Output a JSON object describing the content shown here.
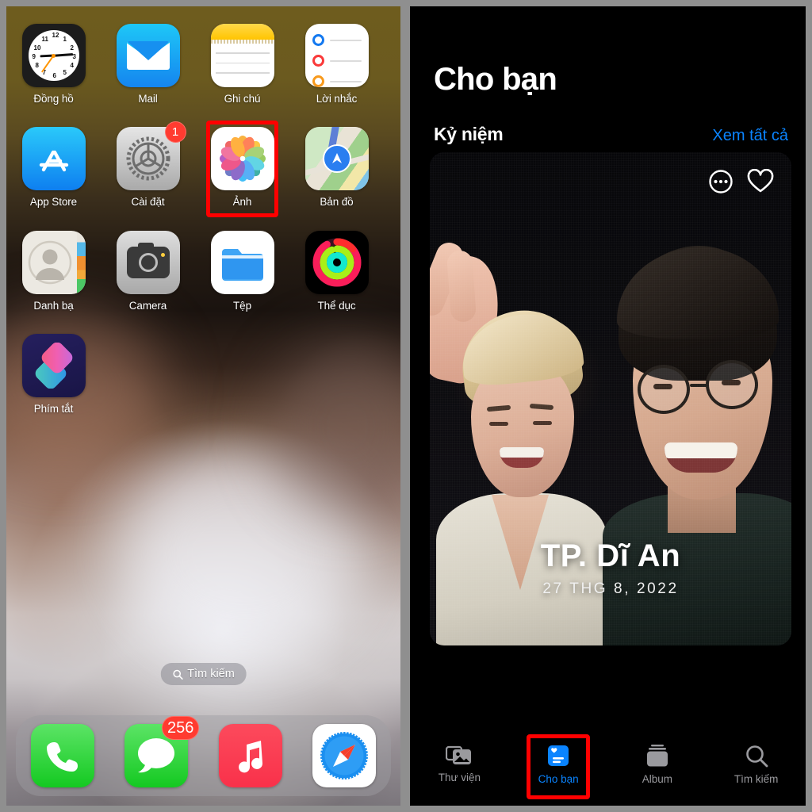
{
  "colors": {
    "highlight": "#ff0000",
    "accent_blue": "#0a84ff",
    "badge_red": "#ff3b30",
    "tab_inactive": "#9a9a9e",
    "panel_bg_dark": "#000000",
    "border_gray": "#8f8f8f"
  },
  "home_screen": {
    "rows": [
      [
        {
          "name": "Đồng hồ",
          "icon": "clock-icon"
        },
        {
          "name": "Mail",
          "icon": "mail-icon"
        },
        {
          "name": "Ghi chú",
          "icon": "notes-icon"
        },
        {
          "name": "Lời nhắc",
          "icon": "reminders-icon"
        }
      ],
      [
        {
          "name": "App Store",
          "icon": "app-store-icon"
        },
        {
          "name": "Cài đặt",
          "icon": "settings-icon",
          "badge": "1"
        },
        {
          "name": "Ảnh",
          "icon": "photos-icon",
          "highlighted": true
        },
        {
          "name": "Bản đồ",
          "icon": "maps-icon"
        }
      ],
      [
        {
          "name": "Danh bạ",
          "icon": "contacts-icon"
        },
        {
          "name": "Camera",
          "icon": "camera-icon"
        },
        {
          "name": "Tệp",
          "icon": "files-icon"
        },
        {
          "name": "Thể dục",
          "icon": "fitness-icon"
        }
      ],
      [
        {
          "name": "Phím tắt",
          "icon": "shortcuts-icon"
        }
      ]
    ],
    "search": {
      "label": "Tìm kiếm",
      "icon": "search-icon"
    },
    "dock": [
      {
        "name": "Phone",
        "icon": "phone-icon"
      },
      {
        "name": "Messages",
        "icon": "messages-icon",
        "badge": "256"
      },
      {
        "name": "Music",
        "icon": "music-icon"
      },
      {
        "name": "Safari",
        "icon": "safari-icon"
      }
    ],
    "clock_reading": "9:15"
  },
  "photos_app": {
    "title": "Cho bạn",
    "section": {
      "title": "Kỷ niệm",
      "see_all": "Xem tất cả"
    },
    "memory_card": {
      "title": "TP. Dĩ An",
      "date": "27 THG 8, 2022",
      "more_icon": "ellipsis-circle-icon",
      "favorite_icon": "heart-icon"
    },
    "tabs": [
      {
        "label": "Thư viện",
        "icon": "library-icon",
        "active": false
      },
      {
        "label": "Cho bạn",
        "icon": "for-you-icon",
        "active": true,
        "highlighted": true
      },
      {
        "label": "Album",
        "icon": "albums-icon",
        "active": false
      },
      {
        "label": "Tìm kiếm",
        "icon": "search-icon",
        "active": false
      }
    ]
  }
}
